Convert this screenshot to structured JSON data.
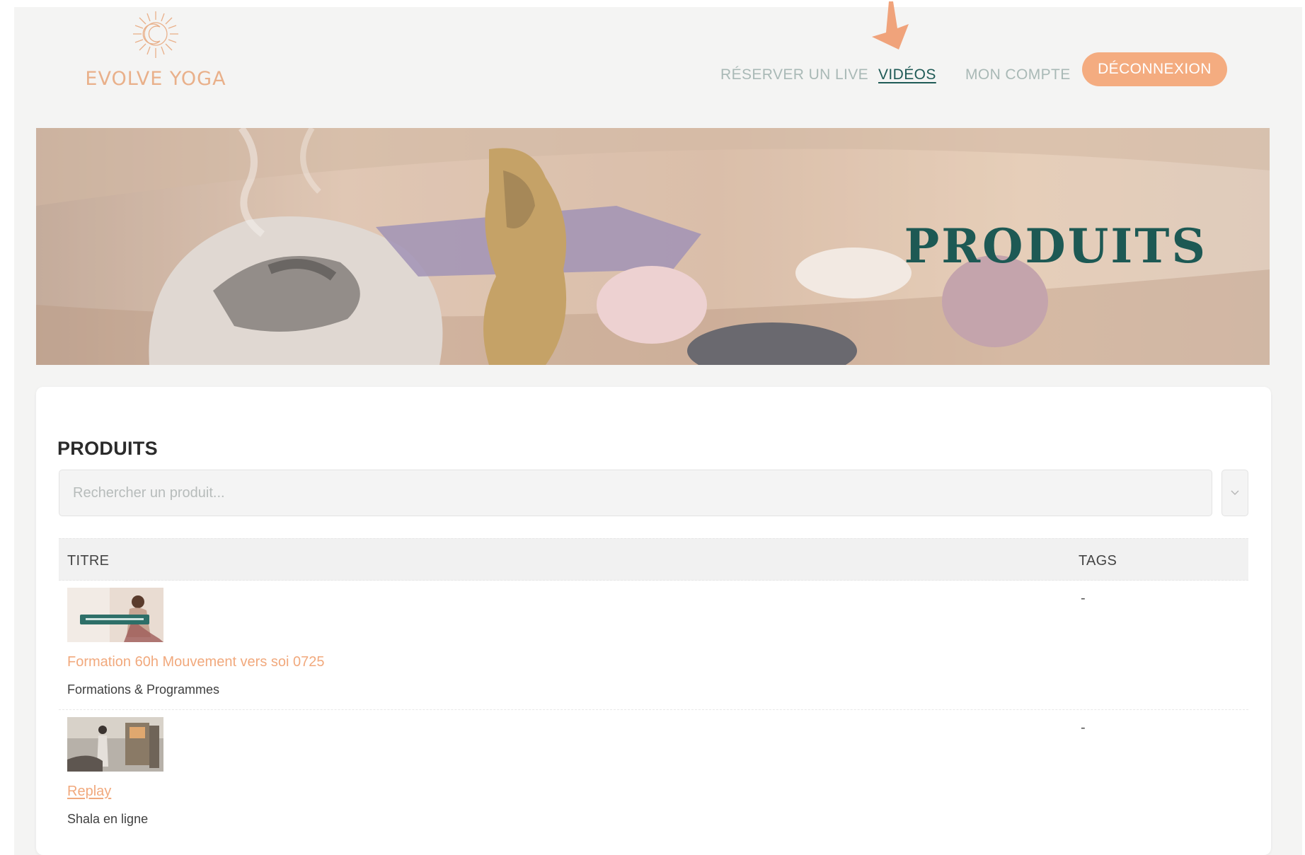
{
  "brand": {
    "name": "EVOLVE YOGA"
  },
  "nav": {
    "links": [
      {
        "label": "RÉSERVER UN LIVE"
      },
      {
        "label": "VIDÉOS"
      },
      {
        "label": "MON COMPTE"
      }
    ],
    "logout_label": "DÉCONNEXION",
    "active": "VIDÉOS"
  },
  "banner": {
    "title": "PRODUITS"
  },
  "products": {
    "title": "PRODUITS",
    "search_placeholder": "Rechercher un produit...",
    "columns": {
      "title": "TITRE",
      "tags": "TAGS"
    },
    "rows": [
      {
        "title": "Formation 60h Mouvement vers soi 0725",
        "category": "Formations & Programmes",
        "tags": "-"
      },
      {
        "title": "Replay",
        "category": "Shala en ligne",
        "tags": "-"
      }
    ]
  },
  "colors": {
    "accent": "#f4ac80",
    "brand_green": "#1d5954",
    "nav_muted": "#a9b9b6",
    "link": "#f1a97d"
  },
  "icons": [
    "sun-moon-logo-icon",
    "chevron-down-icon",
    "arrow-annotation-icon"
  ]
}
